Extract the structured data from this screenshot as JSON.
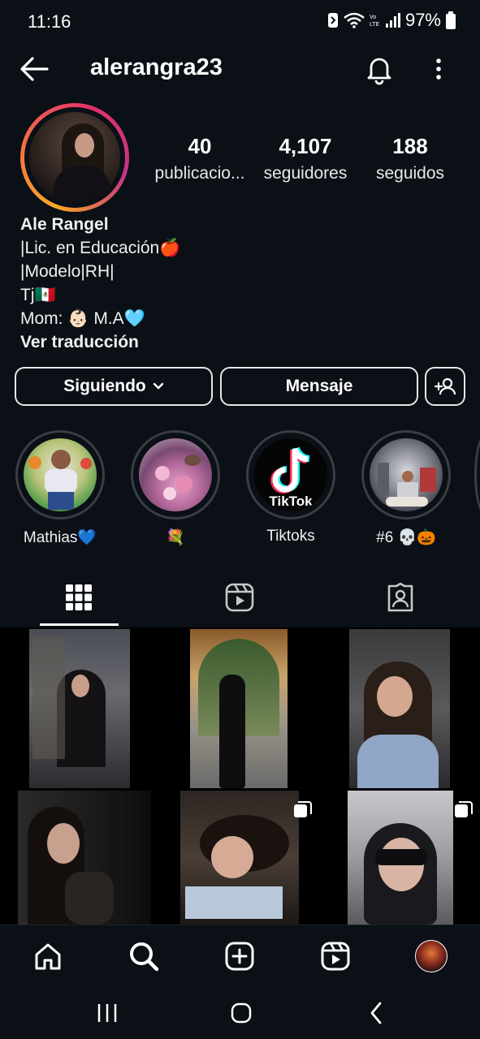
{
  "status_bar": {
    "time": "11:16",
    "battery": "97%"
  },
  "header": {
    "username": "alerangra23"
  },
  "stats": [
    {
      "value": "40",
      "label": "publicacio..."
    },
    {
      "value": "4,107",
      "label": "seguidores"
    },
    {
      "value": "188",
      "label": "seguidos"
    }
  ],
  "bio": {
    "name": "Ale Rangel",
    "lines": [
      "|Lic. en Educación🍎",
      "|Modelo|RH|",
      "Tj🇲🇽",
      "Mom: 👶🏻 M.A🩵"
    ],
    "translate": "Ver traducción"
  },
  "actions": {
    "following": "Siguiendo",
    "message": "Mensaje"
  },
  "highlights": [
    {
      "label": "Mathias💙"
    },
    {
      "label": "💐"
    },
    {
      "label": "Tiktoks",
      "logo_text": "TikTok"
    },
    {
      "label": "#6 💀🎃"
    }
  ],
  "icons": {
    "back": "arrow-left-icon",
    "notifications": "bell-icon",
    "more": "more-vertical-icon",
    "add_user": "person-add-icon",
    "posts_tab": "grid-icon",
    "reels_tab": "reels-icon",
    "tagged_tab": "tagged-person-icon",
    "home": "home-icon",
    "search": "search-icon",
    "create": "plus-square-icon",
    "reels": "reels-icon",
    "profile": "avatar"
  },
  "colors": {
    "background": "#0b0f16",
    "text": "#f5f5f5",
    "button_border": "#e6e6e6",
    "tiktok_cyan": "#25f4ee",
    "tiktok_red": "#fe2c55"
  }
}
